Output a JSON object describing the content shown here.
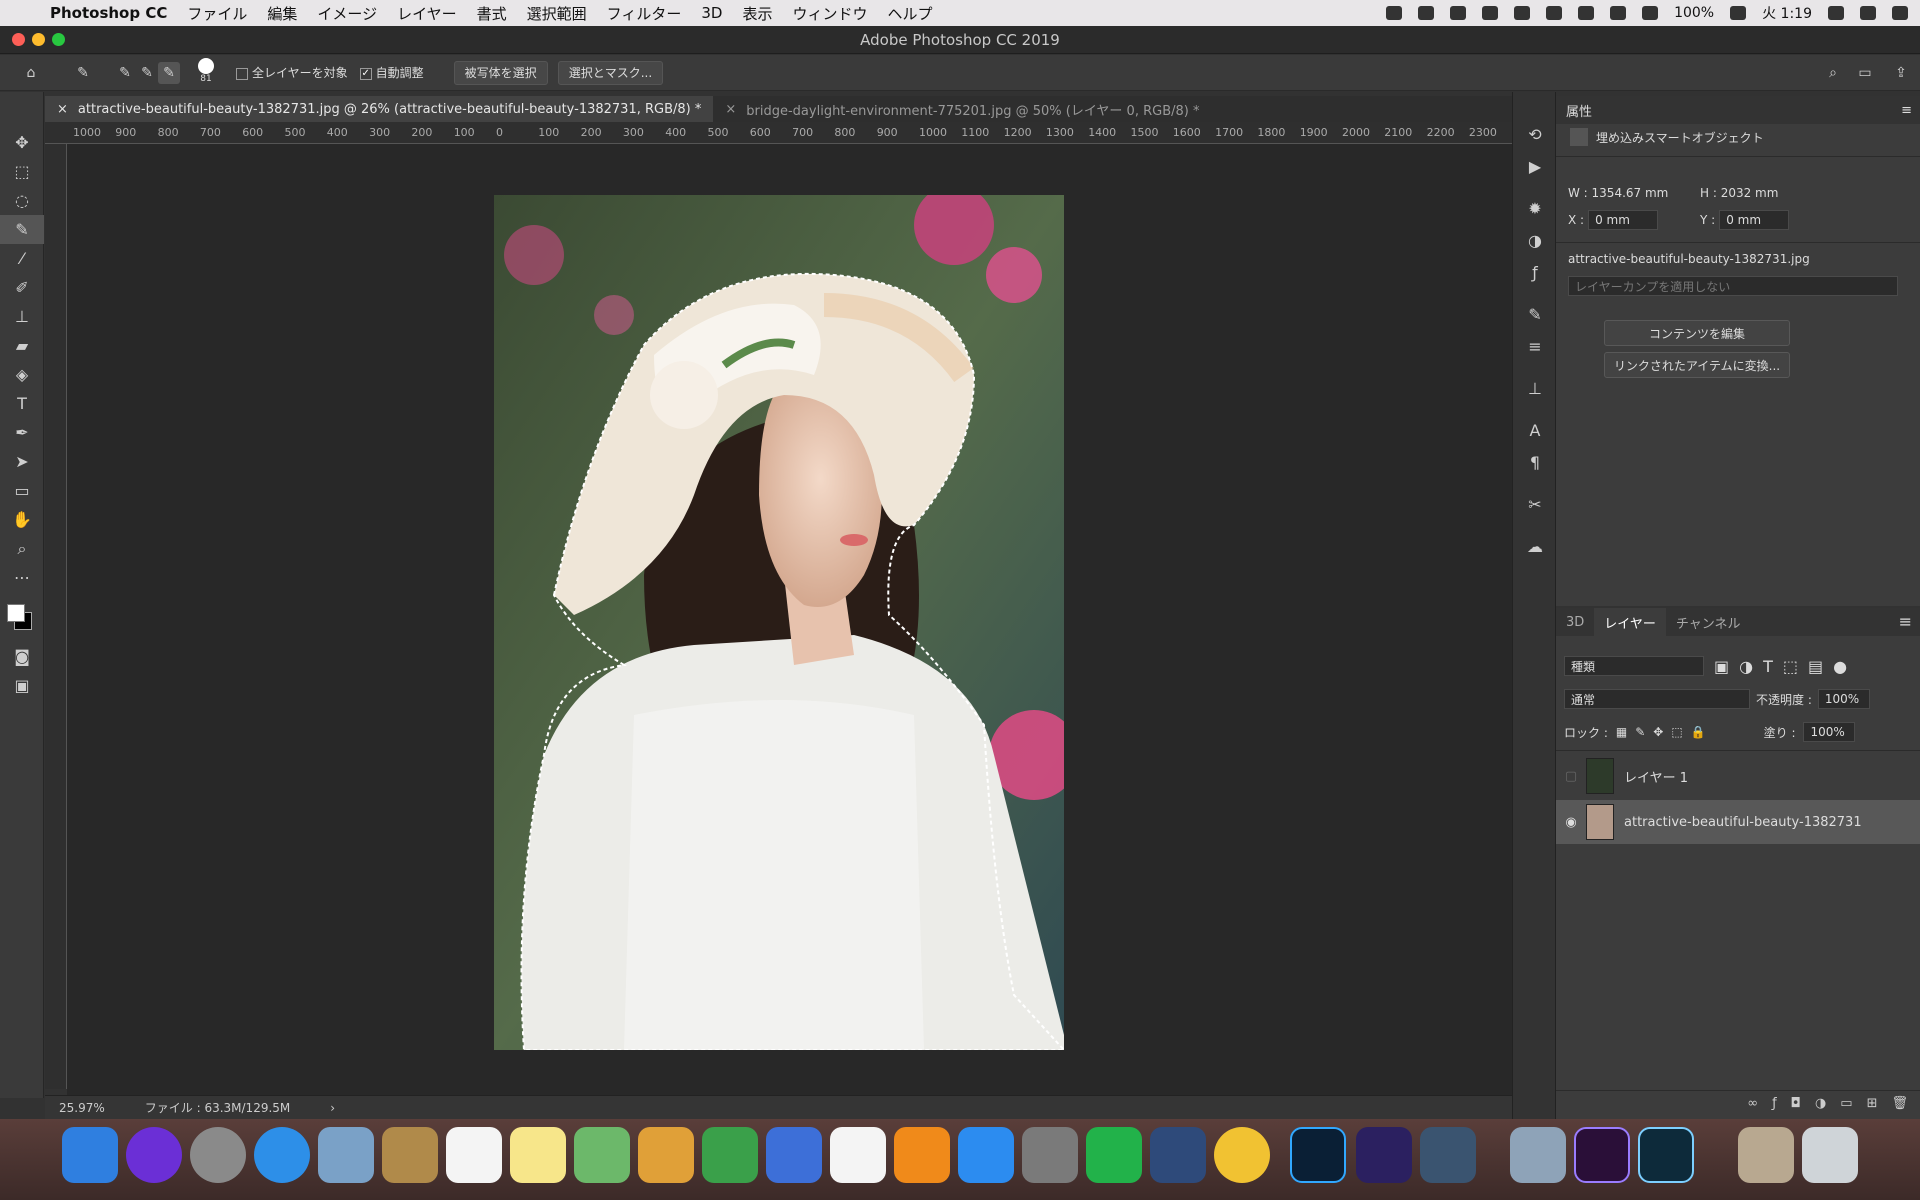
{
  "menubar": {
    "app_name": "Photoshop CC",
    "menus": [
      "ファイル",
      "編集",
      "イメージ",
      "レイヤー",
      "書式",
      "選択範囲",
      "フィルター",
      "3D",
      "表示",
      "ウィンドウ",
      "ヘルプ"
    ],
    "battery": "100%",
    "clock": "火 1:19"
  },
  "window": {
    "title": "Adobe Photoshop CC 2019"
  },
  "options": {
    "brush_size": "81",
    "sample_all_layers": "全レイヤーを対象",
    "auto_enhance": "自動調整",
    "select_subject": "被写体を選択",
    "select_and_mask": "選択とマスク..."
  },
  "tabs": [
    {
      "label": "attractive-beautiful-beauty-1382731.jpg @ 26% (attractive-beautiful-beauty-1382731, RGB/8) *"
    },
    {
      "label": "bridge-daylight-environment-775201.jpg @ 50% (レイヤー 0, RGB/8) *"
    }
  ],
  "ruler": {
    "labels": [
      "1000",
      "900",
      "800",
      "700",
      "600",
      "500",
      "400",
      "300",
      "200",
      "100",
      "0",
      "100",
      "200",
      "300",
      "400",
      "500",
      "600",
      "700",
      "800",
      "900",
      "1000",
      "1100",
      "1200",
      "1300",
      "1400",
      "1500",
      "1600",
      "1700",
      "1800",
      "1900",
      "2000",
      "2100",
      "2200",
      "2300"
    ]
  },
  "status": {
    "zoom": "25.97%",
    "file": "ファイル : 63.3M/129.5M"
  },
  "properties": {
    "title": "属性",
    "kind": "埋め込みスマートオブジェクト",
    "w": "W : 1354.67 mm",
    "h": "H : 2032 mm",
    "x_label": "X :",
    "x_value": "0 mm",
    "y_label": "Y :",
    "y_value": "0 mm",
    "filename": "attractive-beautiful-beauty-1382731.jpg",
    "comp": "レイヤーカンプを適用しない",
    "edit_contents": "コンテンツを編集",
    "convert_linked": "リンクされたアイテムに変換..."
  },
  "layers_panel": {
    "tabs": [
      "3D",
      "レイヤー",
      "チャンネル"
    ],
    "filter_kind": "種類",
    "blend_mode": "通常",
    "opacity_label": "不透明度 :",
    "opacity_value": "100%",
    "lock_label": "ロック :",
    "fill_label": "塗り :",
    "fill_value": "100%",
    "layers": [
      {
        "name": "レイヤー 1"
      },
      {
        "name": "attractive-beautiful-beauty-1382731"
      }
    ]
  },
  "colors": {
    "accent": "#1473e6",
    "panel": "#3c3c3c",
    "canvas": "#282828"
  }
}
